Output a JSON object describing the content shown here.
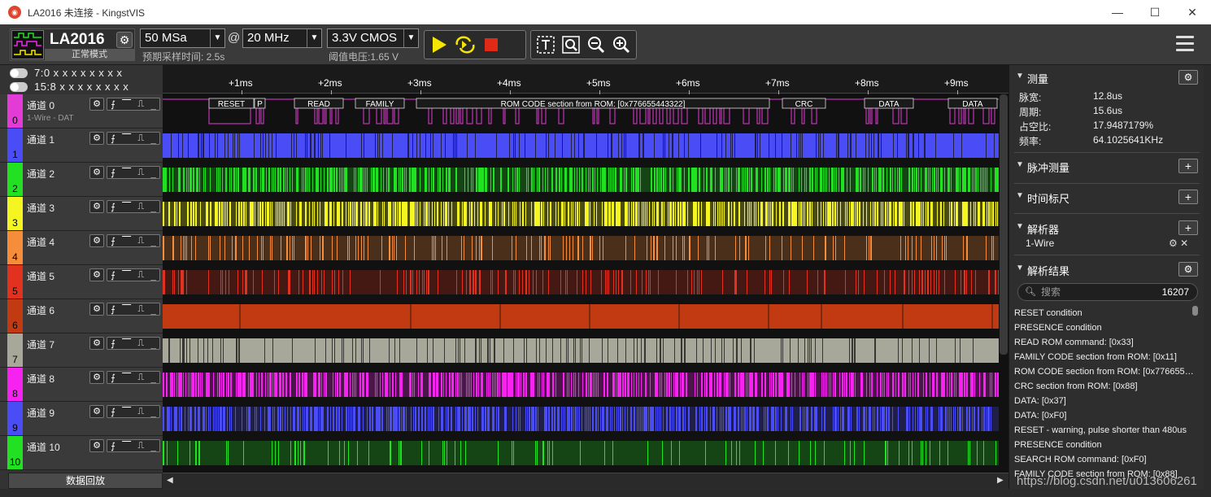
{
  "window": {
    "title": "LA2016 未连接 - KingstVIS",
    "minimize": "—",
    "maximize": "☐",
    "close": "✕"
  },
  "toolbar": {
    "device_name": "LA2016",
    "device_mode": "正常模式",
    "sample_depth": "50 MSa",
    "at": "@",
    "sample_rate": "20 MHz",
    "threshold": "3.3V CMOS",
    "expected_time": "预期采样时间: 2.5s",
    "threshold_voltage": "阈值电压:1.65 V",
    "colors": {
      "run": "#f5e600",
      "loop": "#f5e600",
      "stop": "#e02a16"
    }
  },
  "groups": [
    {
      "label": "7:0  x x x x x x x x"
    },
    {
      "label": "15:8  x x x x x x x x"
    }
  ],
  "channels": [
    {
      "name": "通道 0",
      "num": "0",
      "sub": "1-Wire - DAT",
      "color": "#e23bd6"
    },
    {
      "name": "通道 1",
      "num": "1",
      "sub": "",
      "color": "#4a4cf5"
    },
    {
      "name": "通道 2",
      "num": "2",
      "sub": "",
      "color": "#22e022"
    },
    {
      "name": "通道 3",
      "num": "3",
      "sub": "",
      "color": "#f5f522"
    },
    {
      "name": "通道 4",
      "num": "4",
      "sub": "",
      "color": "#f58d3a"
    },
    {
      "name": "通道 5",
      "num": "5",
      "sub": "",
      "color": "#e0321e"
    },
    {
      "name": "通道 6",
      "num": "6",
      "sub": "",
      "color": "#c23a12"
    },
    {
      "name": "通道 7",
      "num": "7",
      "sub": "",
      "color": "#a8a89a"
    },
    {
      "name": "通道 8",
      "num": "8",
      "sub": "",
      "color": "#f522f0"
    },
    {
      "name": "通道 9",
      "num": "9",
      "sub": "",
      "color": "#4a4cf5"
    },
    {
      "name": "通道 10",
      "num": "10",
      "sub": "",
      "color": "#22e022"
    }
  ],
  "channel_trigger_glyphs": [
    "⨍",
    "⎺",
    "⎍",
    "_"
  ],
  "replay_label": "数据回放",
  "ruler": {
    "ticks": [
      "+1ms",
      "+2ms",
      "+3ms",
      "+4ms",
      "+5ms",
      "+6ms",
      "+7ms",
      "+8ms",
      "+9ms"
    ]
  },
  "decode_labels": [
    {
      "text": "RESET"
    },
    {
      "text": "P"
    },
    {
      "text": "READ"
    },
    {
      "text": "FAMILY"
    },
    {
      "text": "ROM CODE section from ROM: [0x776655443322]"
    },
    {
      "text": "CRC"
    },
    {
      "text": "DATA"
    },
    {
      "text": "DATA"
    }
  ],
  "panel": {
    "measure": {
      "title": "测量",
      "rows": [
        {
          "label": "脉宽:",
          "value": "12.8us"
        },
        {
          "label": "周期:",
          "value": "15.6us"
        },
        {
          "label": "占空比:",
          "value": "17.9487179%"
        },
        {
          "label": "频率:",
          "value": "64.1025641KHz"
        }
      ]
    },
    "pulse": {
      "title": "脉冲测量"
    },
    "timeruler": {
      "title": "时间标尺"
    },
    "decoder": {
      "title": "解析器",
      "item": "1-Wire"
    },
    "results": {
      "title": "解析结果",
      "search_placeholder": "搜索",
      "count": "16207",
      "items": [
        "RESET condition",
        "PRESENCE condition",
        "READ ROM command: [0x33]",
        "FAMILY CODE section from ROM: [0x11]",
        "ROM CODE section from ROM: [0x7766554...",
        "CRC section from ROM: [0x88]",
        "DATA: [0x37]",
        "DATA: [0xF0]",
        "RESET - warning, pulse shorter than 480us",
        "PRESENCE condition",
        "SEARCH ROM command: [0xF0]",
        "FAMILY CODE section from ROM: [0x88]"
      ]
    }
  },
  "watermark": "https://blog.csdn.net/u013606261"
}
